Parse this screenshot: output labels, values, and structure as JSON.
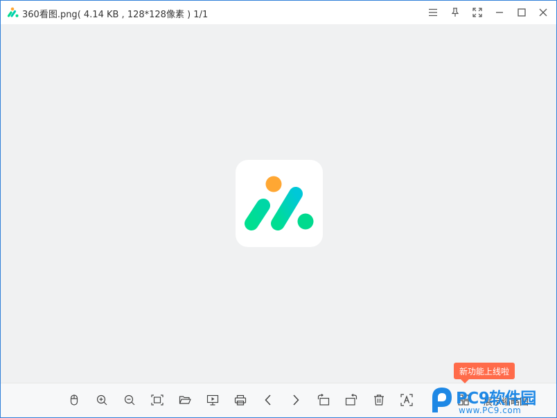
{
  "titlebar": {
    "app_icon": "app-logo-icon",
    "filename": "360看图.png",
    "info": "( 4.14 KB , 128*128像素 )",
    "counter": "1/1",
    "buttons": [
      "menu-icon",
      "pin-icon",
      "fullscreen-icon",
      "minimize-icon",
      "maximize-icon",
      "close-icon"
    ]
  },
  "viewer": {
    "colors": {
      "background": "#f0f1f2",
      "orange": "#ffa733",
      "green": "#00d98e",
      "teal": "#00c9d4"
    }
  },
  "toolbar": {
    "tools": [
      "mouse-icon",
      "zoom-in-icon",
      "zoom-out-icon",
      "fit-window-icon",
      "open-folder-icon",
      "slideshow-icon",
      "print-icon",
      "prev-icon",
      "next-icon",
      "rotate-left-icon",
      "rotate-right-icon",
      "delete-icon",
      "ocr-text-icon",
      "thumbnail-icon"
    ],
    "thumbnail_label": "展示缩略图"
  },
  "tooltip": {
    "text": "新功能上线啦",
    "color": "#ff6b4a"
  },
  "watermark": {
    "main": "PC9软件园",
    "sub": "www.PC9.com",
    "color": "#1e88e5"
  }
}
